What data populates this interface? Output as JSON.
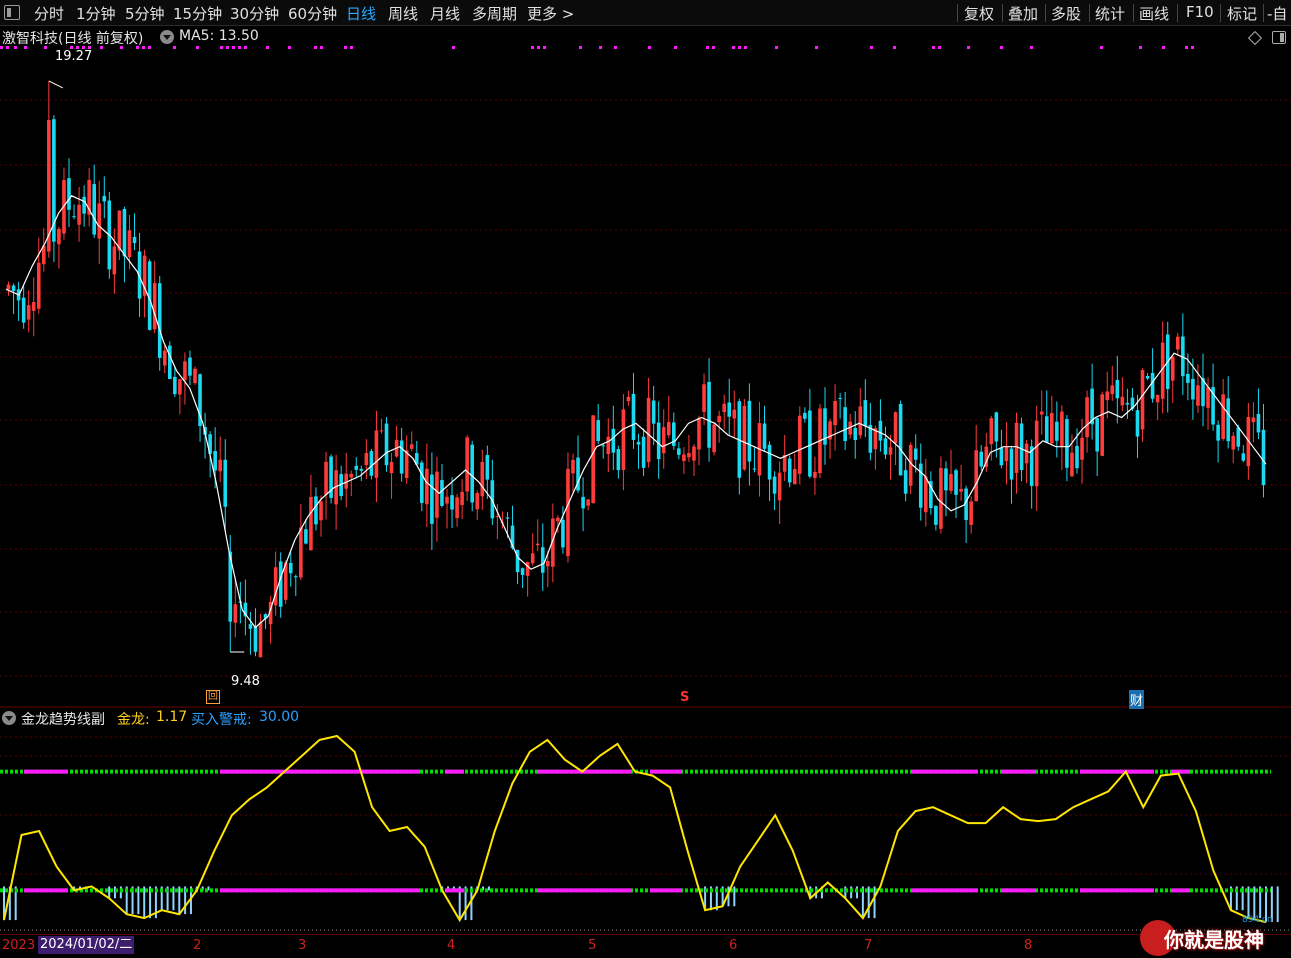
{
  "toolbar": {
    "tabs": [
      "分时",
      "1分钟",
      "5分钟",
      "15分钟",
      "30分钟",
      "60分钟",
      "日线",
      "周线",
      "月线",
      "多周期",
      "更多 >"
    ],
    "active_tab": "日线",
    "right_tabs": [
      "复权",
      "叠加",
      "多股",
      "统计",
      "画线",
      "F10",
      "标记",
      "-自"
    ]
  },
  "main_chart": {
    "stock_title": "激智科技(日线 前复权)",
    "ma_label": "MA5: 13.50",
    "high_label": "19.27",
    "low_label": "9.48",
    "markers": {
      "return_mark": "回",
      "s_mark": "S",
      "finance_mark": "财"
    }
  },
  "indicator": {
    "name": "金龙趋势线副",
    "jinlong_label": "金龙:",
    "jinlong_value": "1.17",
    "buy_label": "买入警戒:",
    "buy_value": "30.00"
  },
  "x_axis": {
    "year_label": "2023",
    "current_date": "2024/01/02/二",
    "months": [
      "2",
      "3",
      "4",
      "5",
      "6",
      "7",
      "8"
    ]
  },
  "watermark": {
    "text": "你就是股神",
    "url": "894.cn"
  },
  "colors": {
    "up": "#ff3b3b",
    "down": "#1ad9f0",
    "ma": "#ffffff",
    "jinlong": "#ffe600",
    "band": "#ff1aff",
    "dash": "#00dd00",
    "bar": "#8fd3ff"
  },
  "chart_data": {
    "type": "candlestick",
    "ylim": [
      9.0,
      19.8
    ],
    "high": 19.27,
    "low": 9.48,
    "ma5_last": 13.5,
    "ma5_path": [
      15.7,
      15.6,
      16.1,
      16.5,
      17.0,
      17.3,
      17.2,
      16.8,
      16.6,
      16.3,
      16.0,
      15.5,
      14.8,
      14.3,
      14.0,
      13.4,
      12.4,
      11.2,
      10.2,
      9.9,
      10.1,
      10.8,
      11.4,
      11.8,
      12.1,
      12.3,
      12.4,
      12.5,
      12.7,
      12.9,
      13.0,
      12.8,
      12.4,
      12.2,
      12.4,
      12.6,
      12.4,
      12.1,
      11.6,
      11.1,
      10.9,
      11.0,
      11.6,
      12.1,
      12.6,
      13.0,
      13.1,
      13.3,
      13.4,
      13.2,
      13.0,
      13.1,
      13.4,
      13.5,
      13.4,
      13.2,
      13.1,
      13.0,
      12.9,
      12.8,
      12.9,
      13.0,
      13.1,
      13.2,
      13.3,
      13.4,
      13.3,
      13.2,
      13.0,
      12.7,
      12.5,
      12.1,
      11.9,
      12.0,
      12.4,
      12.9,
      13.0,
      13.0,
      12.9,
      13.1,
      13.0,
      13.0,
      13.3,
      13.5,
      13.6,
      13.5,
      13.7,
      14.0,
      14.3,
      14.6,
      14.5,
      14.2,
      13.9,
      13.6,
      13.3,
      13.0,
      12.7
    ],
    "ma5_dates_note": "",
    "indicator_ylim": [
      0,
      100
    ],
    "jinlong_series": [
      5,
      48,
      50,
      32,
      20,
      22,
      16,
      8,
      6,
      10,
      8,
      20,
      40,
      58,
      66,
      72,
      80,
      88,
      96,
      98,
      90,
      62,
      50,
      52,
      42,
      20,
      5,
      20,
      50,
      74,
      90,
      96,
      86,
      80,
      88,
      94,
      80,
      78,
      72,
      40,
      10,
      12,
      32,
      45,
      58,
      40,
      16,
      24,
      16,
      6,
      22,
      50,
      60,
      62,
      58,
      54,
      54,
      62,
      56,
      55,
      56,
      62,
      66,
      70,
      80,
      62,
      78,
      79,
      60,
      30,
      10,
      6,
      4
    ]
  }
}
